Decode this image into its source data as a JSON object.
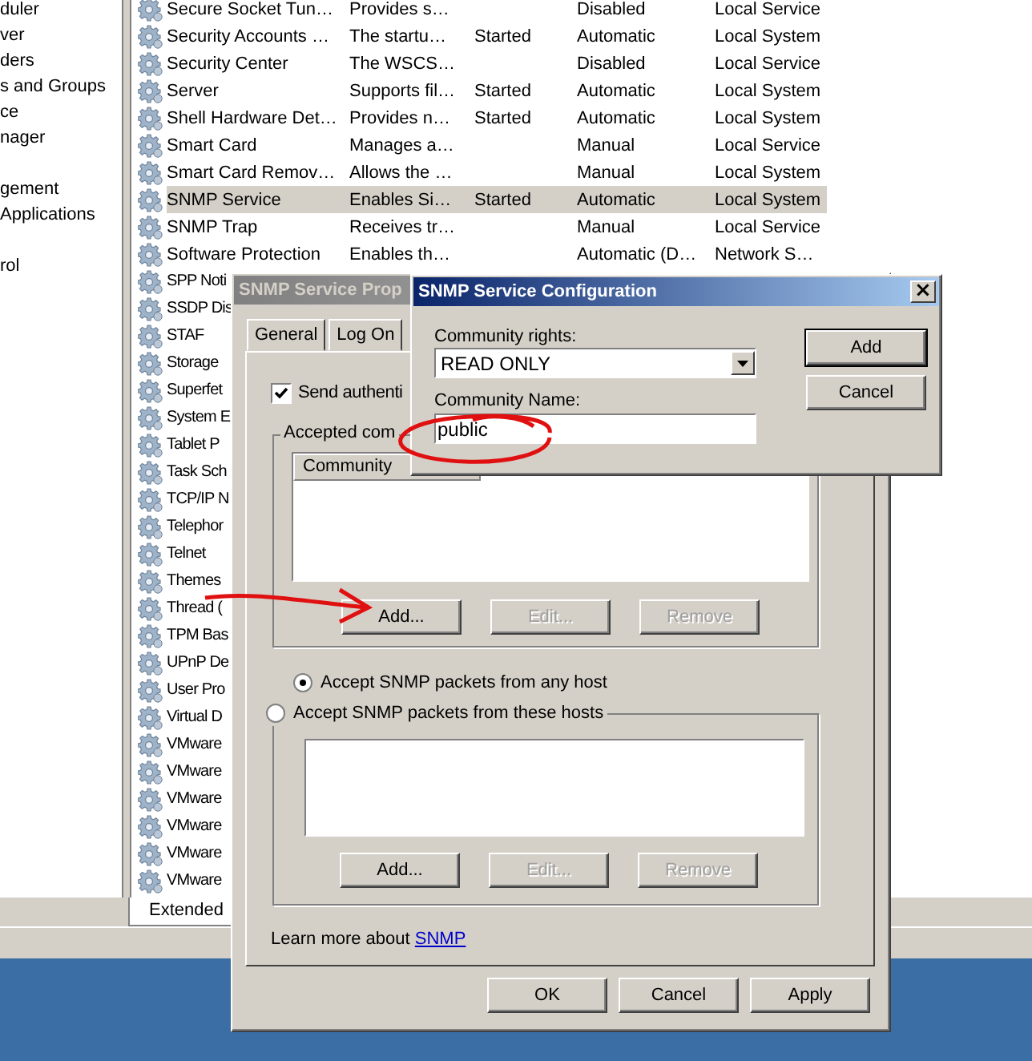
{
  "tree": {
    "items": [
      {
        "label": "duler",
        "gap_before": false
      },
      {
        "label": "ver",
        "gap_before": false
      },
      {
        "label": "ders",
        "gap_before": false
      },
      {
        "label": "s and Groups",
        "gap_before": false
      },
      {
        "label": "ce",
        "gap_before": false
      },
      {
        "label": "nager",
        "gap_before": false
      },
      {
        "label": "gement",
        "gap_before": true
      },
      {
        "label": "Applications",
        "gap_before": false
      },
      {
        "label": "rol",
        "gap_before": true
      }
    ]
  },
  "services": {
    "rows": [
      {
        "name": "Secure Socket Tun…",
        "description": "Provides s…",
        "startup": "Disabled",
        "logon": "Local Service",
        "selected": false
      },
      {
        "name": "Security Accounts …",
        "description": "The startu…",
        "status": "Started",
        "startup": "Automatic",
        "logon": "Local System",
        "selected": false
      },
      {
        "name": "Security Center",
        "description": "The WSCS…",
        "startup": "Disabled",
        "logon": "Local Service",
        "selected": false
      },
      {
        "name": "Server",
        "description": "Supports fil…",
        "status": "Started",
        "startup": "Automatic",
        "logon": "Local System",
        "selected": false
      },
      {
        "name": "Shell Hardware Det…",
        "description": "Provides n…",
        "status": "Started",
        "startup": "Automatic",
        "logon": "Local System",
        "selected": false
      },
      {
        "name": "Smart Card",
        "description": "Manages a…",
        "startup": "Manual",
        "logon": "Local Service",
        "selected": false
      },
      {
        "name": "Smart Card Remov…",
        "description": "Allows the …",
        "startup": "Manual",
        "logon": "Local System",
        "selected": false
      },
      {
        "name": "SNMP Service",
        "description": "Enables Si…",
        "status": "Started",
        "startup": "Automatic",
        "logon": "Local System",
        "selected": true
      },
      {
        "name": "SNMP Trap",
        "description": "Receives tr…",
        "startup": "Manual",
        "logon": "Local Service",
        "selected": false
      },
      {
        "name": "Software Protection",
        "description": "Enables th…",
        "startup": "Automatic (D…",
        "logon": "Network S…",
        "selected": false
      },
      {
        "name": "SPP Noti",
        "selected": false
      },
      {
        "name": "SSDP Dis",
        "selected": false
      },
      {
        "name": "STAF",
        "selected": false
      },
      {
        "name": "Storage",
        "selected": false
      },
      {
        "name": "Superfet",
        "selected": false
      },
      {
        "name": "System E",
        "selected": false
      },
      {
        "name": "Tablet P",
        "selected": false
      },
      {
        "name": "Task Sch",
        "selected": false
      },
      {
        "name": "TCP/IP N",
        "selected": false
      },
      {
        "name": "Telephor",
        "selected": false
      },
      {
        "name": "Telnet",
        "selected": false
      },
      {
        "name": "Themes",
        "selected": false
      },
      {
        "name": "Thread (",
        "selected": false
      },
      {
        "name": "TPM Bas",
        "selected": false
      },
      {
        "name": "UPnP De",
        "selected": false
      },
      {
        "name": "User Pro",
        "selected": false
      },
      {
        "name": "Virtual D",
        "selected": false
      },
      {
        "name": "VMware",
        "selected": false
      },
      {
        "name": "VMware",
        "selected": false
      },
      {
        "name": "VMware",
        "selected": false
      },
      {
        "name": "VMware",
        "selected": false
      },
      {
        "name": "VMware",
        "selected": false
      },
      {
        "name": "VMware",
        "selected": false
      }
    ]
  },
  "view_tabs": [
    {
      "label": "Extended",
      "selected": true
    }
  ],
  "properties_dialog": {
    "title": "SNMP Service Prop",
    "tabs": [
      {
        "label": "General",
        "selected": false
      },
      {
        "label": "Log On",
        "selected": false
      }
    ],
    "send_auth": {
      "label": "Send authenti",
      "checked": true
    },
    "accepted_group": {
      "title": "Accepted com",
      "columns": [
        "Community"
      ],
      "buttons": [
        {
          "label": "Add...",
          "disabled": false
        },
        {
          "label": "Edit...",
          "disabled": true
        },
        {
          "label": "Remove",
          "disabled": true
        }
      ]
    },
    "host_options": [
      {
        "label": "Accept SNMP packets from any host",
        "selected": true
      },
      {
        "label": "Accept SNMP packets from these hosts",
        "selected": false
      }
    ],
    "hosts_buttons": [
      {
        "label": "Add...",
        "disabled": false
      },
      {
        "label": "Edit...",
        "disabled": true
      },
      {
        "label": "Remove",
        "disabled": true
      }
    ],
    "learn_more": {
      "text": "Learn more about",
      "link": "SNMP"
    },
    "buttons": [
      {
        "label": "OK"
      },
      {
        "label": "Cancel"
      },
      {
        "label": "Apply"
      }
    ]
  },
  "config_dialog": {
    "title": "SNMP Service Configuration",
    "close": "×",
    "rights_label": "Community rights:",
    "rights_value": "READ ONLY",
    "name_label": "Community Name:",
    "name_value": "public",
    "buttons": [
      {
        "label": "Add",
        "default": true
      },
      {
        "label": "Cancel",
        "default": false
      }
    ]
  }
}
